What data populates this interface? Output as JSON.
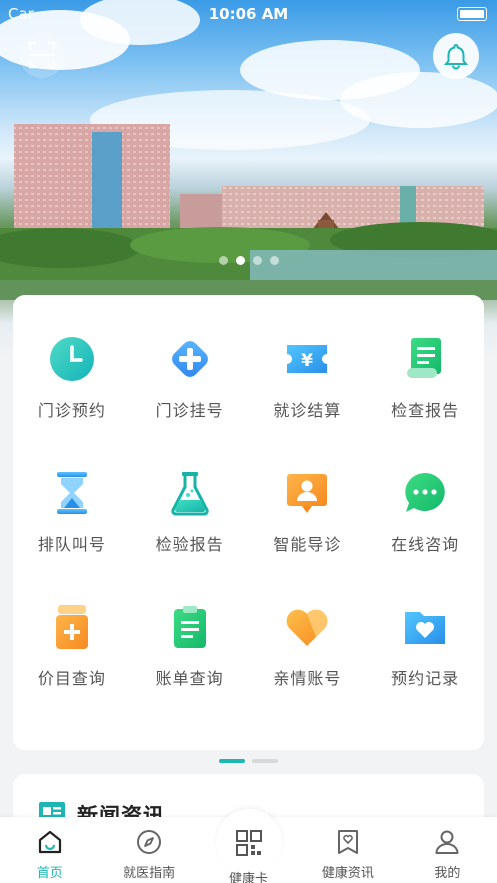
{
  "status_bar": {
    "carrier": "Car",
    "time": "10:06 AM"
  },
  "banner": {
    "slide_count": 4,
    "active_slide": 1
  },
  "grid": {
    "items": [
      {
        "label": "门诊预约",
        "icon": "clock-icon"
      },
      {
        "label": "门诊挂号",
        "icon": "plus-cross-icon"
      },
      {
        "label": "就诊结算",
        "icon": "yen-ticket-icon"
      },
      {
        "label": "检查报告",
        "icon": "scroll-report-icon"
      },
      {
        "label": "排队叫号",
        "icon": "hourglass-icon"
      },
      {
        "label": "检验报告",
        "icon": "flask-icon"
      },
      {
        "label": "智能导诊",
        "icon": "person-board-icon"
      },
      {
        "label": "在线咨询",
        "icon": "chat-bubble-icon"
      },
      {
        "label": "价目查询",
        "icon": "medicine-bottle-icon"
      },
      {
        "label": "账单查询",
        "icon": "clipboard-icon"
      },
      {
        "label": "亲情账号",
        "icon": "heart-icon"
      },
      {
        "label": "预约记录",
        "icon": "heart-folder-icon"
      }
    ]
  },
  "pager": {
    "pages": 2,
    "active": 0
  },
  "news": {
    "title": "新闻资讯"
  },
  "tabbar": {
    "tabs": [
      {
        "label": "首页",
        "icon": "home-icon",
        "active": true
      },
      {
        "label": "就医指南",
        "icon": "compass-icon",
        "active": false
      },
      {
        "label": "健康卡",
        "icon": "qr-code-icon",
        "active": false
      },
      {
        "label": "健康资讯",
        "icon": "heart-bookmark-icon",
        "active": false
      },
      {
        "label": "我的",
        "icon": "user-icon",
        "active": false
      }
    ]
  },
  "colors": {
    "accent": "#1eb6b4",
    "text": "#555555"
  }
}
